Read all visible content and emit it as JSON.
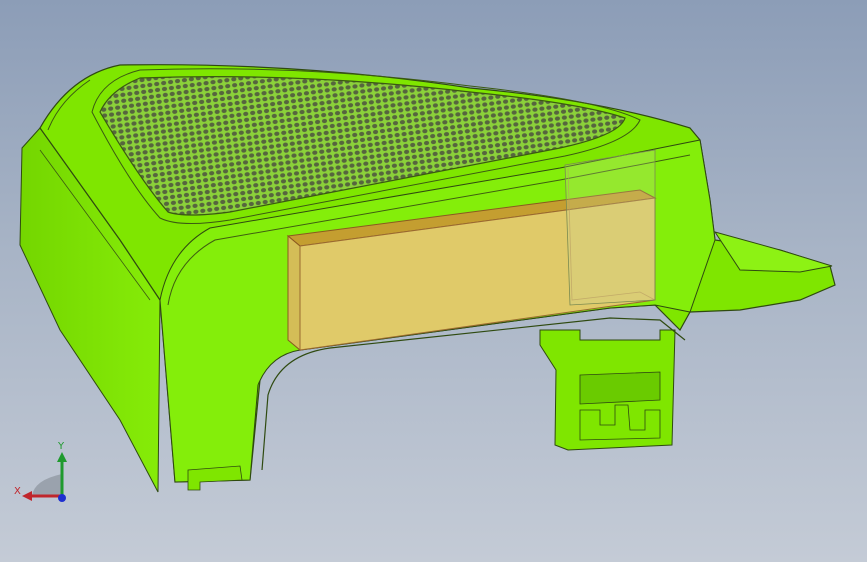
{
  "viewport": {
    "background_top": "#8c9db7",
    "background_bottom": "#c4cbd6"
  },
  "model": {
    "body_color": "#7fe600",
    "body_shade": "#66c400",
    "edge_color": "#2a3a10",
    "mesh_color": "#5c6f3f",
    "transparent_box_color": "#f0c37a"
  },
  "triad": {
    "x_label": "X",
    "y_label": "Y",
    "x_color": "#c0262c",
    "y_color": "#1f9a2e",
    "z_color": "#1e2fd0"
  }
}
